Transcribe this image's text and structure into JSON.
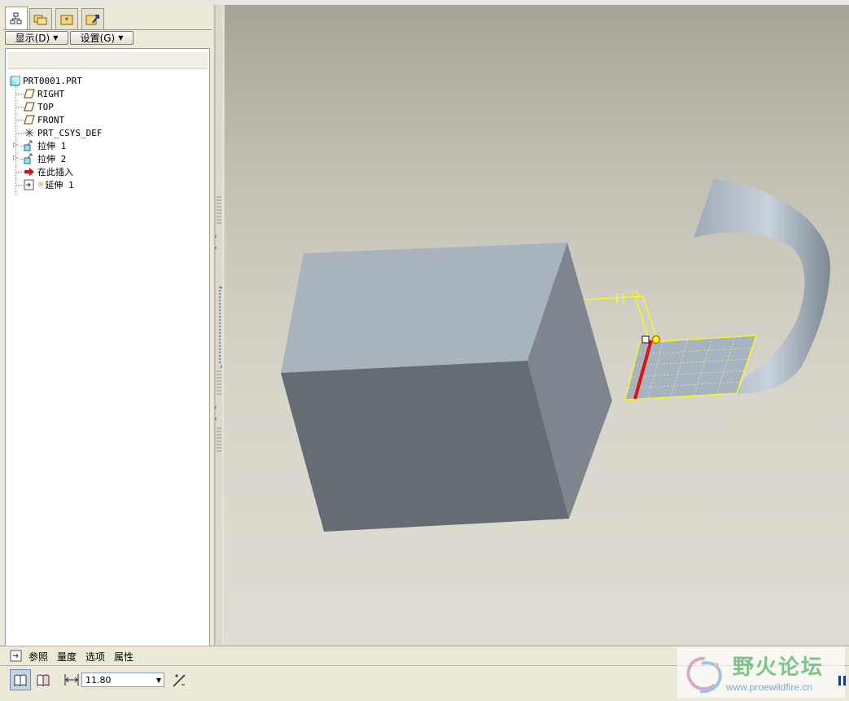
{
  "panel": {
    "tabs": [
      {
        "name": "model-tree-icon",
        "active": true
      },
      {
        "name": "folder-browser-icon",
        "active": false
      },
      {
        "name": "favorites-icon",
        "active": false
      },
      {
        "name": "connections-icon",
        "active": false
      }
    ],
    "show_menu": "显示(D)",
    "settings_menu": "设置(G)"
  },
  "tree": {
    "items": [
      {
        "label": "PRT0001.PRT",
        "icon": "part-icon",
        "expandable": false
      },
      {
        "label": "RIGHT",
        "icon": "datum-plane-icon",
        "expandable": false
      },
      {
        "label": "TOP",
        "icon": "datum-plane-icon",
        "expandable": false
      },
      {
        "label": "FRONT",
        "icon": "datum-plane-icon",
        "expandable": false
      },
      {
        "label": "PRT_CSYS_DEF",
        "icon": "csys-icon",
        "expandable": false
      },
      {
        "label": "拉伸 1",
        "icon": "extrude-icon",
        "expandable": true
      },
      {
        "label": "拉伸 2",
        "icon": "extrude-icon",
        "expandable": true
      },
      {
        "label": "在此插入",
        "icon": "insert-here-arrow-icon",
        "expandable": false
      },
      {
        "label": "延伸 1",
        "icon": "extend-feature-icon",
        "expandable": false
      }
    ]
  },
  "dashboard": {
    "tabs": [
      "参照",
      "量度",
      "选项",
      "属性"
    ],
    "depth_value": "11.80"
  },
  "watermark": {
    "title": "野火论坛",
    "url": "www.proewildfire.cn"
  },
  "colors": {
    "face_top": "#a9b3bd",
    "face_front": "#646c74",
    "face_right": "#7d868f",
    "highlight_yellow": "#ffff00",
    "edge_red": "#e01010"
  }
}
